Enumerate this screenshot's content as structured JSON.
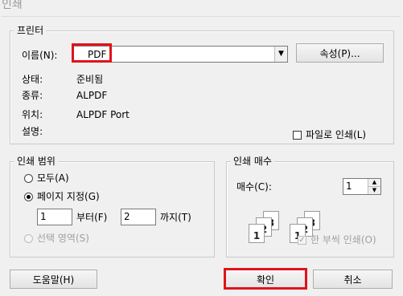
{
  "window": {
    "title": "인쇄"
  },
  "printer": {
    "group_label": "프린터",
    "name_label": "이름(N):",
    "name_value": "PDF",
    "properties_button": "속성(P)...",
    "status_label": "상태:",
    "status_value": "준비됨",
    "type_label": "종류:",
    "type_value": "ALPDF",
    "where_label": "위치:",
    "where_value": "ALPDF Port",
    "comment_label": "설명:",
    "print_to_file_label": "파일로 인쇄(L)"
  },
  "range": {
    "group_label": "인쇄 범위",
    "all_label": "모두(A)",
    "pages_label": "페이지 지정(G)",
    "from_value": "1",
    "from_label": "부터(F)",
    "to_value": "2",
    "to_label": "까지(T)",
    "selection_label": "선택 영역(S)"
  },
  "copies": {
    "group_label": "인쇄 매수",
    "count_label": "매수(C):",
    "count_value": "1",
    "page_numbers": [
      "1",
      "2",
      "3"
    ],
    "collate_label": "한 부씩 인쇄(O)"
  },
  "footer": {
    "help_button": "도움말(H)",
    "ok_button": "확인",
    "cancel_button": "취소"
  },
  "colors": {
    "highlight": "#e0131b",
    "background": "#f0f0f0"
  }
}
